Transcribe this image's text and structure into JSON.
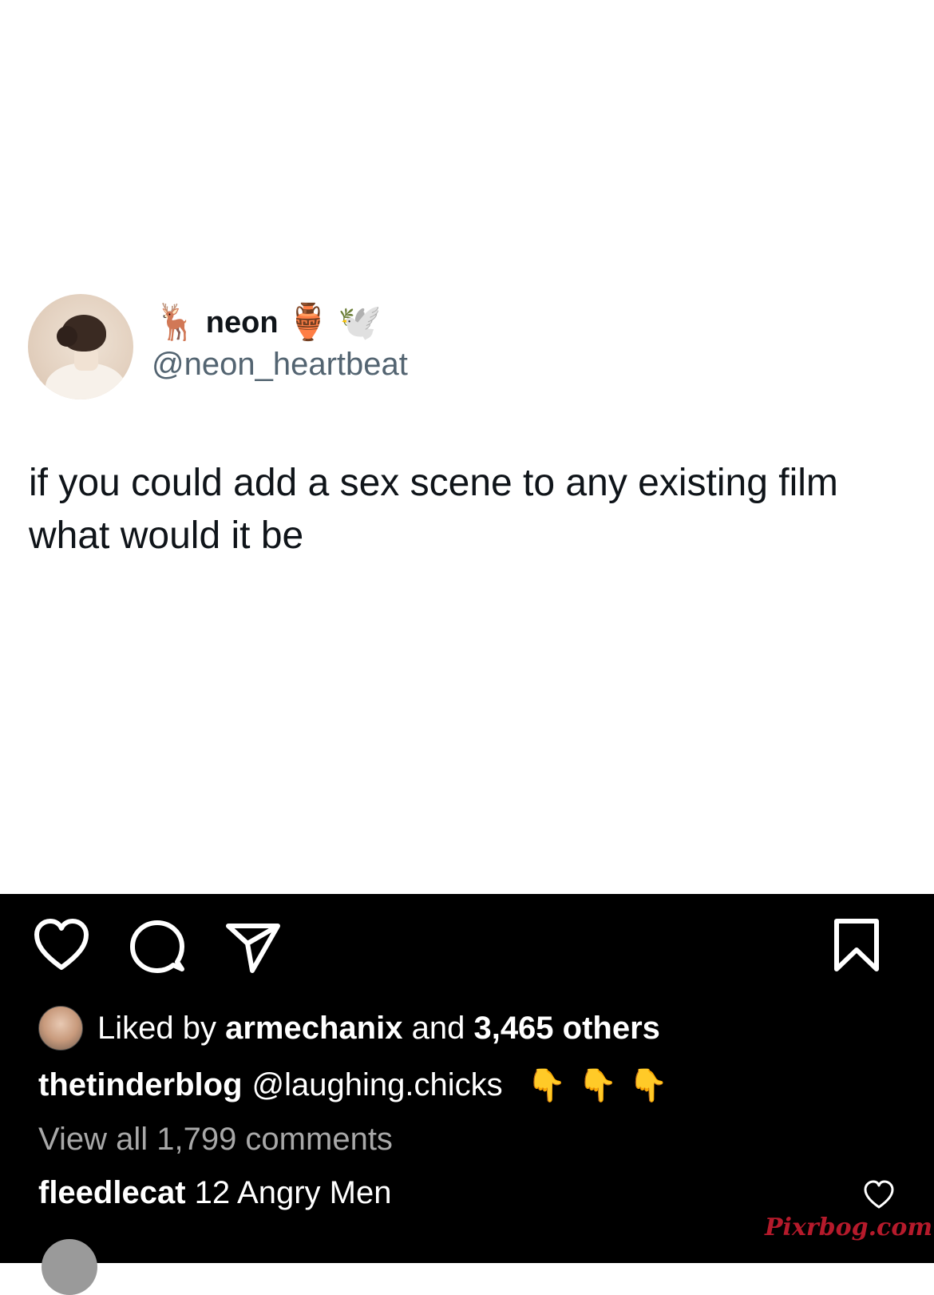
{
  "tweet": {
    "display_name": "neon",
    "name_emoji_before": "🦌",
    "name_emoji_after_1": "🏺",
    "name_emoji_after_2": "🕊️",
    "handle": "@neon_heartbeat",
    "text": "if you could add a sex scene to any existing film what would it be"
  },
  "post": {
    "icons": [
      "heart-icon",
      "comment-icon",
      "share-icon",
      "bookmark-icon"
    ],
    "likes": {
      "prefix": "Liked by",
      "user": "armechanix",
      "middle": "and",
      "count_text": "3,465 others"
    },
    "caption": {
      "user": "thetinderblog",
      "mention": "@laughing.chicks",
      "emojis": "👇👇👇"
    },
    "view_all_comments": "View all 1,799 comments",
    "comment": {
      "user": "fleedlecat",
      "text": "12 Angry Men"
    },
    "watermark": "Pixrbog.com"
  }
}
